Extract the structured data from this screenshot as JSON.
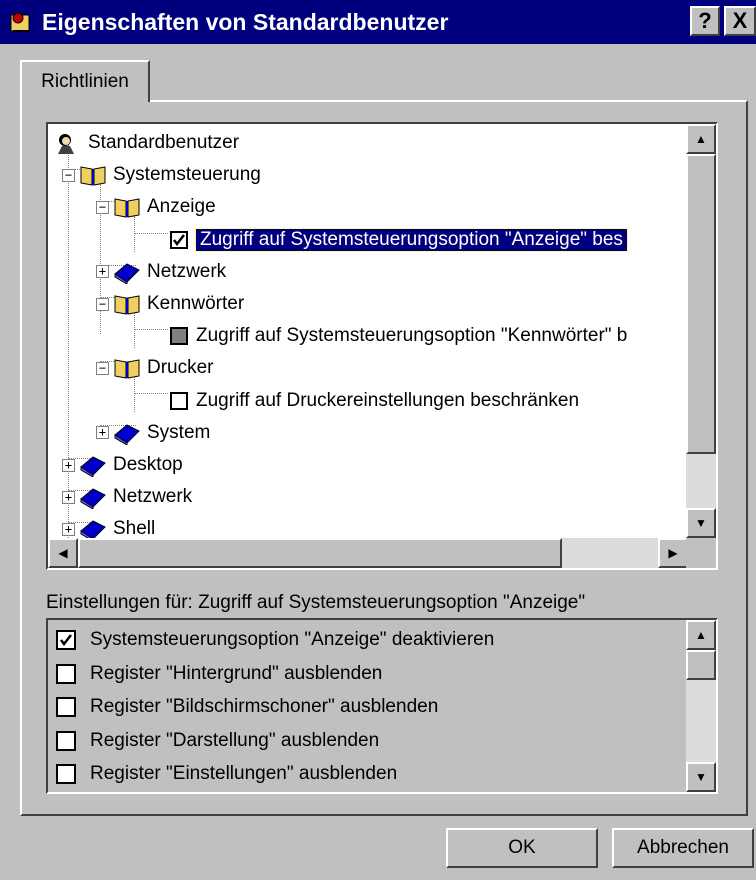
{
  "window": {
    "title": "Eigenschaften von Standardbenutzer",
    "help_label": "?",
    "close_label": "X"
  },
  "tab": {
    "label": "Richtlinien"
  },
  "tree": {
    "items": [
      {
        "label": "Standardbenutzer",
        "icon": "user-icon",
        "expander": ""
      },
      {
        "label": "Systemsteuerung",
        "icon": "open-book-icon",
        "expander": "−"
      },
      {
        "label": "Anzeige",
        "icon": "open-book-icon",
        "expander": "−"
      },
      {
        "label": "Zugriff auf Systemsteuerungsoption \"Anzeige\"  bes",
        "icon": "checkbox-checked",
        "expander": ""
      },
      {
        "label": "Netzwerk",
        "icon": "closed-book-icon",
        "expander": "+"
      },
      {
        "label": "Kennwörter",
        "icon": "open-book-icon",
        "expander": "−"
      },
      {
        "label": "Zugriff auf Systemsteuerungsoption \"Kennwörter\" b",
        "icon": "checkbox-gray",
        "expander": ""
      },
      {
        "label": "Drucker",
        "icon": "open-book-icon",
        "expander": "−"
      },
      {
        "label": "Zugriff auf Druckereinstellungen beschränken",
        "icon": "checkbox-empty",
        "expander": ""
      },
      {
        "label": "System",
        "icon": "closed-book-icon",
        "expander": "+"
      },
      {
        "label": "Desktop",
        "icon": "closed-book-icon",
        "expander": "+"
      },
      {
        "label": "Netzwerk",
        "icon": "closed-book-icon",
        "expander": "+"
      },
      {
        "label": "Shell",
        "icon": "closed-book-icon",
        "expander": "+"
      }
    ]
  },
  "settings": {
    "label": "Einstellungen für: Zugriff auf Systemsteuerungsoption \"Anzeige\"",
    "options": [
      {
        "label": "Systemsteuerungsoption \"Anzeige\" deaktivieren",
        "checked": true
      },
      {
        "label": "Register \"Hintergrund\" ausblenden",
        "checked": false
      },
      {
        "label": "Register \"Bildschirmschoner\" ausblenden",
        "checked": false
      },
      {
        "label": "Register \"Darstellung\" ausblenden",
        "checked": false
      },
      {
        "label": "Register \"Einstellungen\" ausblenden",
        "checked": false
      }
    ]
  },
  "buttons": {
    "ok": "OK",
    "cancel": "Abbrechen"
  },
  "colors": {
    "face": "#c0c0c0",
    "title": "#00007f",
    "selection": "#00007f",
    "book": "#0000cc",
    "open_book": "#f0d060"
  }
}
